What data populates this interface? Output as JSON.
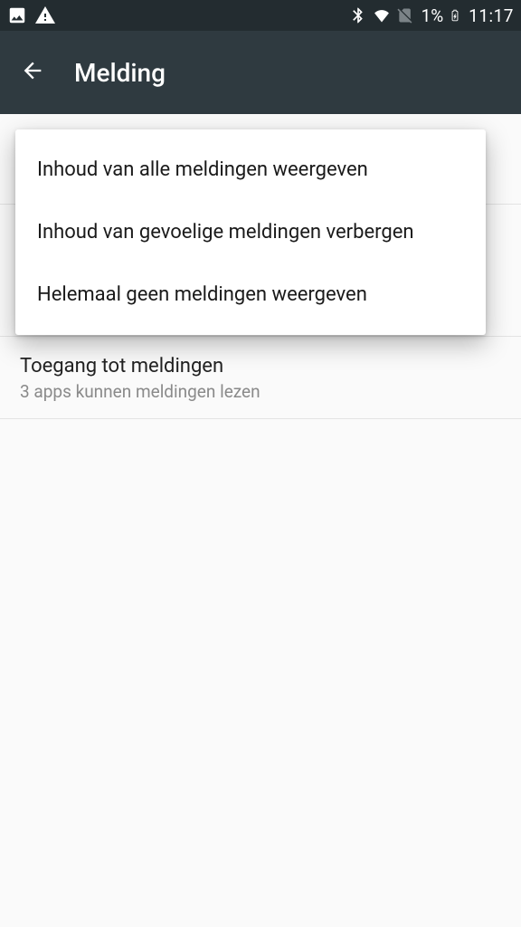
{
  "status": {
    "battery_pct": "1%",
    "time": "11:17"
  },
  "header": {
    "title": "Melding"
  },
  "popup": {
    "items": [
      {
        "label": "Inhoud van alle meldingen weergeven"
      },
      {
        "label": "Inhoud van gevoelige meldingen verbergen"
      },
      {
        "label": "Helemaal geen meldingen weergeven"
      }
    ]
  },
  "background_item": {
    "title": "Toegang tot meldingen",
    "subtitle": "3 apps kunnen meldingen lezen"
  }
}
